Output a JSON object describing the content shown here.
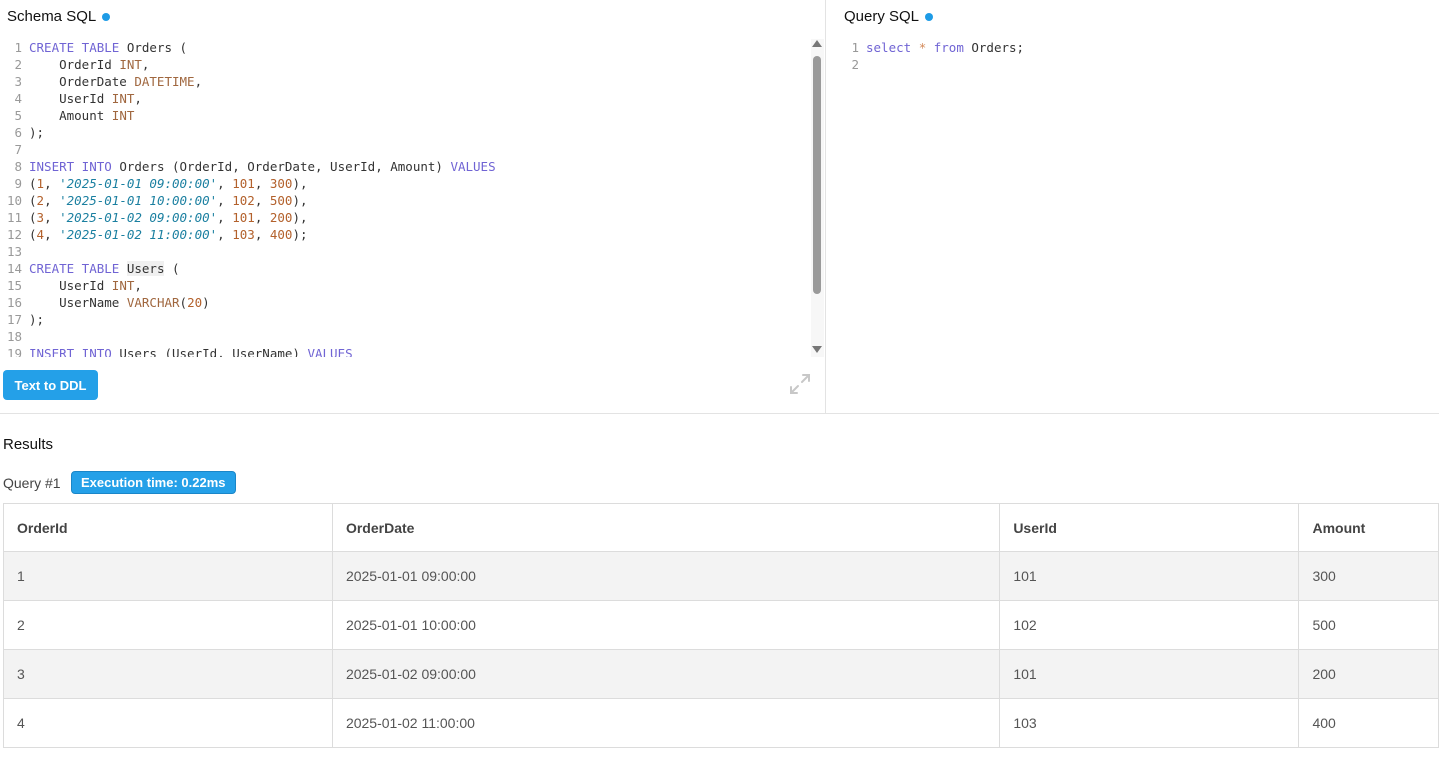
{
  "schema": {
    "title": "Schema SQL",
    "ddl_button": "Text to DDL",
    "lines": [
      [
        {
          "t": "CREATE TABLE",
          "c": "kw"
        },
        {
          "t": " Orders (",
          "c": ""
        }
      ],
      [
        {
          "t": "    OrderId ",
          "c": ""
        },
        {
          "t": "INT",
          "c": "ty"
        },
        {
          "t": ",",
          "c": ""
        }
      ],
      [
        {
          "t": "    OrderDate ",
          "c": ""
        },
        {
          "t": "DATETIME",
          "c": "ty"
        },
        {
          "t": ",",
          "c": ""
        }
      ],
      [
        {
          "t": "    UserId ",
          "c": ""
        },
        {
          "t": "INT",
          "c": "ty"
        },
        {
          "t": ",",
          "c": ""
        }
      ],
      [
        {
          "t": "    Amount ",
          "c": ""
        },
        {
          "t": "INT",
          "c": "ty"
        }
      ],
      [
        {
          "t": ");",
          "c": ""
        }
      ],
      [],
      [
        {
          "t": "INSERT INTO",
          "c": "kw"
        },
        {
          "t": " Orders (OrderId, OrderDate, UserId, Amount) ",
          "c": ""
        },
        {
          "t": "VALUES",
          "c": "kw"
        }
      ],
      [
        {
          "t": "(",
          "c": ""
        },
        {
          "t": "1",
          "c": "num"
        },
        {
          "t": ", ",
          "c": ""
        },
        {
          "t": "'2025-01-01 09:00:00'",
          "c": "str"
        },
        {
          "t": ", ",
          "c": ""
        },
        {
          "t": "101",
          "c": "num"
        },
        {
          "t": ", ",
          "c": ""
        },
        {
          "t": "300",
          "c": "num"
        },
        {
          "t": "),",
          "c": ""
        }
      ],
      [
        {
          "t": "(",
          "c": ""
        },
        {
          "t": "2",
          "c": "num"
        },
        {
          "t": ", ",
          "c": ""
        },
        {
          "t": "'2025-01-01 10:00:00'",
          "c": "str"
        },
        {
          "t": ", ",
          "c": ""
        },
        {
          "t": "102",
          "c": "num"
        },
        {
          "t": ", ",
          "c": ""
        },
        {
          "t": "500",
          "c": "num"
        },
        {
          "t": "),",
          "c": ""
        }
      ],
      [
        {
          "t": "(",
          "c": ""
        },
        {
          "t": "3",
          "c": "num"
        },
        {
          "t": ", ",
          "c": ""
        },
        {
          "t": "'2025-01-02 09:00:00'",
          "c": "str"
        },
        {
          "t": ", ",
          "c": ""
        },
        {
          "t": "101",
          "c": "num"
        },
        {
          "t": ", ",
          "c": ""
        },
        {
          "t": "200",
          "c": "num"
        },
        {
          "t": "),",
          "c": ""
        }
      ],
      [
        {
          "t": "(",
          "c": ""
        },
        {
          "t": "4",
          "c": "num"
        },
        {
          "t": ", ",
          "c": ""
        },
        {
          "t": "'2025-01-02 11:00:00'",
          "c": "str"
        },
        {
          "t": ", ",
          "c": ""
        },
        {
          "t": "103",
          "c": "num"
        },
        {
          "t": ", ",
          "c": ""
        },
        {
          "t": "400",
          "c": "num"
        },
        {
          "t": ");",
          "c": ""
        }
      ],
      [],
      [
        {
          "t": "CREATE TABLE",
          "c": "kw"
        },
        {
          "t": " ",
          "c": ""
        },
        {
          "t": "Users",
          "c": "hl"
        },
        {
          "t": " (",
          "c": ""
        }
      ],
      [
        {
          "t": "    UserId ",
          "c": ""
        },
        {
          "t": "INT",
          "c": "ty"
        },
        {
          "t": ",",
          "c": ""
        }
      ],
      [
        {
          "t": "    UserName ",
          "c": ""
        },
        {
          "t": "VARCHAR",
          "c": "ty"
        },
        {
          "t": "(",
          "c": ""
        },
        {
          "t": "20",
          "c": "num"
        },
        {
          "t": ")",
          "c": ""
        }
      ],
      [
        {
          "t": ");",
          "c": ""
        }
      ],
      [],
      [
        {
          "t": "INSERT INTO",
          "c": "kw"
        },
        {
          "t": " Users (UserId, UserName) ",
          "c": ""
        },
        {
          "t": "VALUES",
          "c": "kw"
        }
      ]
    ]
  },
  "query": {
    "title": "Query SQL",
    "lines": [
      [
        {
          "t": "select",
          "c": "kw"
        },
        {
          "t": " ",
          "c": ""
        },
        {
          "t": "*",
          "c": "op"
        },
        {
          "t": " ",
          "c": ""
        },
        {
          "t": "from",
          "c": "kw"
        },
        {
          "t": " Orders;",
          "c": ""
        }
      ],
      []
    ]
  },
  "results": {
    "title": "Results",
    "query_label": "Query #1",
    "exec_time": "Execution time: 0.22ms",
    "columns": [
      "OrderId",
      "OrderDate",
      "UserId",
      "Amount"
    ],
    "rows": [
      [
        "1",
        "2025-01-01 09:00:00",
        "101",
        "300"
      ],
      [
        "2",
        "2025-01-01 10:00:00",
        "102",
        "500"
      ],
      [
        "3",
        "2025-01-02 09:00:00",
        "101",
        "200"
      ],
      [
        "4",
        "2025-01-02 11:00:00",
        "103",
        "400"
      ]
    ]
  },
  "icons": {
    "status_dot": "status-dot-icon",
    "expand": "expand-icon",
    "scroll_up": "arrow-up-icon",
    "scroll_down": "arrow-down-icon"
  },
  "colors": {
    "accent": "#24a0e8",
    "keyword": "#7064d4",
    "type": "#a0673f",
    "string": "#1a7fa0"
  }
}
